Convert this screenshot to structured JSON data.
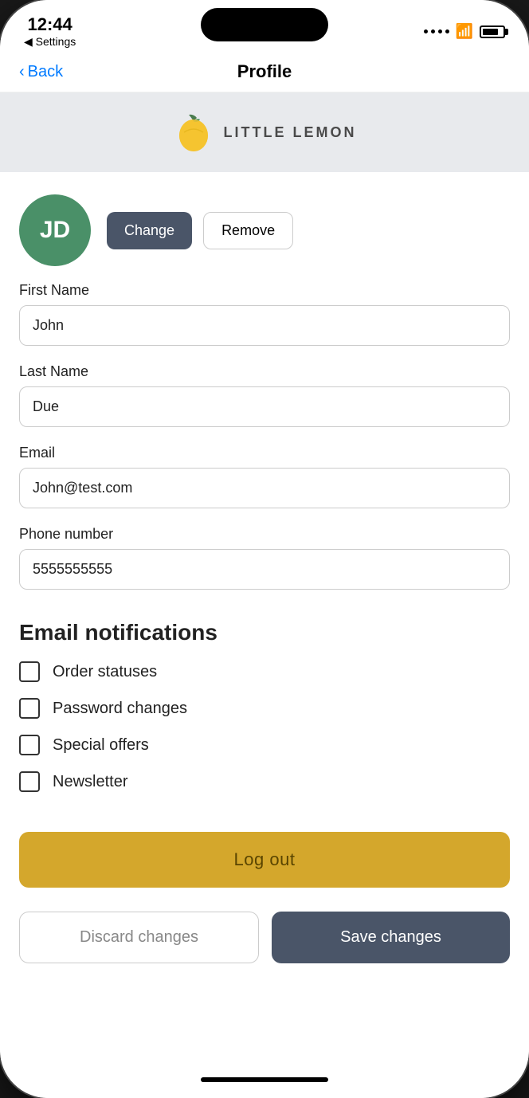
{
  "status": {
    "time": "12:44",
    "settings_label": "◀ Settings"
  },
  "nav": {
    "back_label": "Back",
    "title": "Profile"
  },
  "logo": {
    "text": "LITTLE LEMON"
  },
  "avatar": {
    "initials": "JD",
    "change_label": "Change",
    "remove_label": "Remove"
  },
  "form": {
    "first_name_label": "First Name",
    "first_name_value": "John",
    "last_name_label": "Last Name",
    "last_name_value": "Due",
    "email_label": "Email",
    "email_value": "John@test.com",
    "phone_label": "Phone number",
    "phone_value": "5555555555"
  },
  "notifications": {
    "title": "Email notifications",
    "items": [
      {
        "id": "order-statuses",
        "label": "Order statuses",
        "checked": false
      },
      {
        "id": "password-changes",
        "label": "Password changes",
        "checked": false
      },
      {
        "id": "special-offers",
        "label": "Special offers",
        "checked": false
      },
      {
        "id": "newsletter",
        "label": "Newsletter",
        "checked": false
      }
    ]
  },
  "logout": {
    "label": "Log out"
  },
  "buttons": {
    "discard_label": "Discard changes",
    "save_label": "Save changes"
  },
  "colors": {
    "avatar_bg": "#4a9068",
    "change_btn": "#4a5568",
    "logout_btn": "#d4a72c",
    "save_btn": "#4a5568"
  }
}
